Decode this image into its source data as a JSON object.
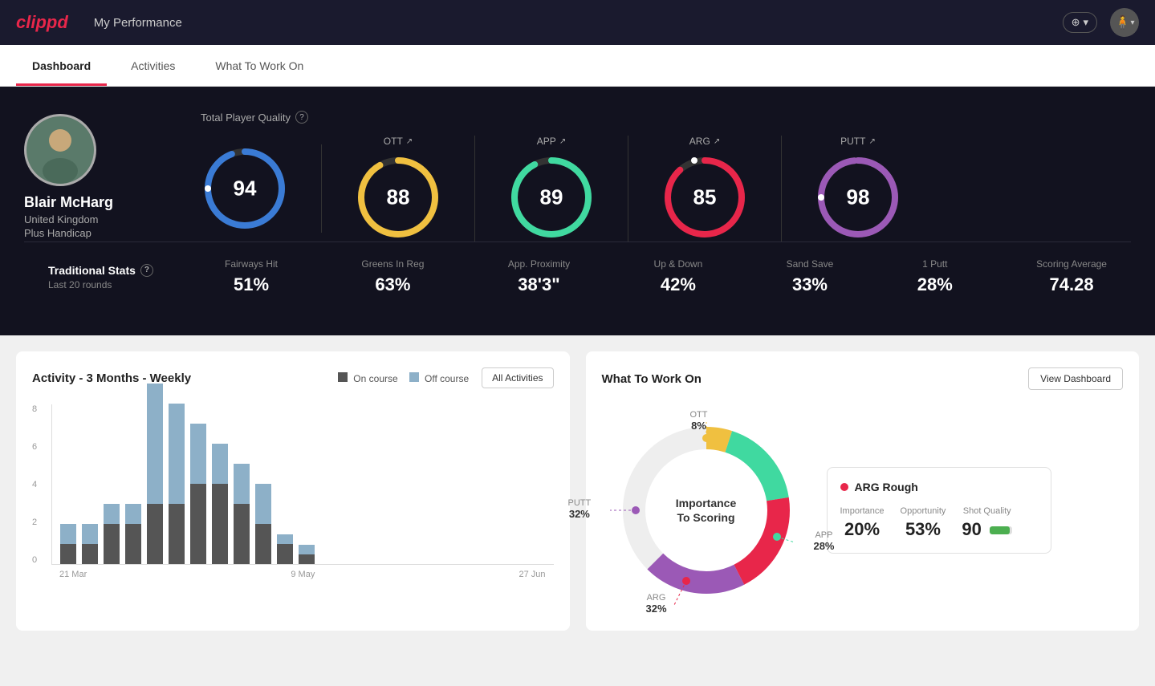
{
  "header": {
    "logo": "clippd",
    "title": "My Performance",
    "add_label": "+ ▾",
    "avatar_label": "👤 ▾"
  },
  "nav": {
    "tabs": [
      {
        "label": "Dashboard",
        "active": true
      },
      {
        "label": "Activities",
        "active": false
      },
      {
        "label": "What To Work On",
        "active": false
      }
    ]
  },
  "player": {
    "name": "Blair McHarg",
    "country": "United Kingdom",
    "handicap": "Plus Handicap",
    "avatar": "🧍"
  },
  "scores": {
    "total_quality_label": "Total Player Quality",
    "total_value": 94,
    "metrics": [
      {
        "label": "OTT",
        "value": 88,
        "color": "#f0c040",
        "bg": "#222"
      },
      {
        "label": "APP",
        "value": 89,
        "color": "#40d9a0",
        "bg": "#222"
      },
      {
        "label": "ARG",
        "value": 85,
        "color": "#e8264a",
        "bg": "#222"
      },
      {
        "label": "PUTT",
        "value": 98,
        "color": "#9b59b6",
        "bg": "#222"
      }
    ]
  },
  "trad_stats": {
    "title": "Traditional Stats",
    "subtitle": "Last 20 rounds",
    "items": [
      {
        "label": "Fairways Hit",
        "value": "51%"
      },
      {
        "label": "Greens In Reg",
        "value": "63%"
      },
      {
        "label": "App. Proximity",
        "value": "38'3\""
      },
      {
        "label": "Up & Down",
        "value": "42%"
      },
      {
        "label": "Sand Save",
        "value": "33%"
      },
      {
        "label": "1 Putt",
        "value": "28%"
      },
      {
        "label": "Scoring Average",
        "value": "74.28"
      }
    ]
  },
  "activity_chart": {
    "title": "Activity - 3 Months - Weekly",
    "legend_on": "On course",
    "legend_off": "Off course",
    "button_label": "All Activities",
    "y_labels": [
      "0",
      "2",
      "4",
      "6",
      "8"
    ],
    "x_labels": [
      "21 Mar",
      "9 May",
      "27 Jun"
    ],
    "bars": [
      {
        "on": 1,
        "off": 1
      },
      {
        "on": 1,
        "off": 1
      },
      {
        "on": 2,
        "off": 1
      },
      {
        "on": 2,
        "off": 1
      },
      {
        "on": 3,
        "off": 6
      },
      {
        "on": 3,
        "off": 5
      },
      {
        "on": 4,
        "off": 3
      },
      {
        "on": 4,
        "off": 2
      },
      {
        "on": 3,
        "off": 2
      },
      {
        "on": 2,
        "off": 2
      },
      {
        "on": 1,
        "off": 0.5
      },
      {
        "on": 0.5,
        "off": 0.5
      }
    ]
  },
  "what_to_work_on": {
    "title": "What To Work On",
    "button_label": "View Dashboard",
    "donut_center": "Importance\nTo Scoring",
    "segments": [
      {
        "label": "OTT",
        "value": "8%",
        "color": "#f0c040",
        "angle": 30
      },
      {
        "label": "APP",
        "value": "28%",
        "color": "#40d9a0",
        "angle": 100
      },
      {
        "label": "ARG",
        "value": "32%",
        "color": "#e8264a",
        "angle": 116
      },
      {
        "label": "PUTT",
        "value": "32%",
        "color": "#9b59b6",
        "angle": 116
      }
    ],
    "arg_card": {
      "dot_color": "#e8264a",
      "title": "ARG Rough",
      "importance_label": "Importance",
      "importance_value": "20%",
      "opportunity_label": "Opportunity",
      "opportunity_value": "53%",
      "shot_quality_label": "Shot Quality",
      "shot_quality_value": "90",
      "shot_quality_pct": 90
    }
  }
}
